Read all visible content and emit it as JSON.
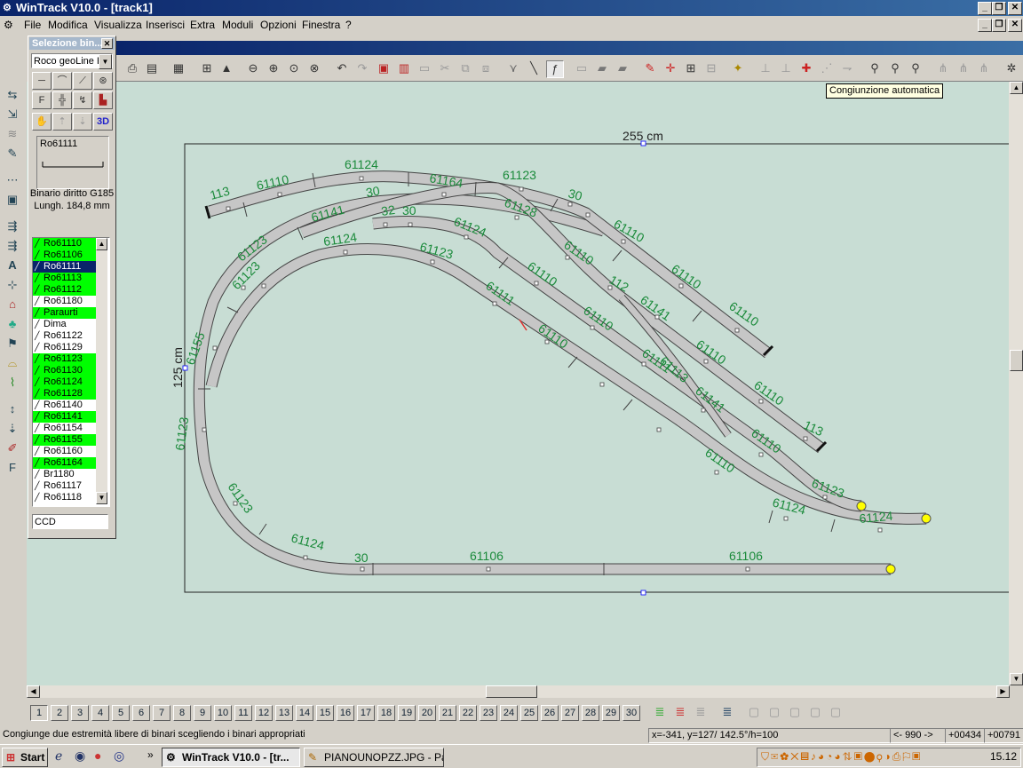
{
  "window": {
    "title": "WinTrack  V10.0 - [track1]",
    "menu": [
      "File",
      "Modifica",
      "Visualizza",
      "Inserisci",
      "Extra",
      "Moduli",
      "Opzioni",
      "Finestra",
      "?"
    ]
  },
  "tooltip": "Congiunzione automatica",
  "palette": {
    "title": "Selezione bin...",
    "dropdown_value": "Roco geoLine R",
    "preview_code": "Ro61111",
    "desc_line1": "Binario diritto G185",
    "desc_line2": "Lungh. 184,8 mm",
    "code_input_value": "CCD",
    "three_d_label": "3D",
    "list": [
      {
        "label": "Ro61110",
        "state": "green"
      },
      {
        "label": "Ro61106",
        "state": "green"
      },
      {
        "label": "Ro61111",
        "state": "selected"
      },
      {
        "label": "Ro61113",
        "state": "green"
      },
      {
        "label": "Ro61112",
        "state": "green"
      },
      {
        "label": "Ro61180",
        "state": "none"
      },
      {
        "label": "Paraurti",
        "state": "green"
      },
      {
        "label": "Dima",
        "state": "none"
      },
      {
        "label": "Ro61122",
        "state": "none"
      },
      {
        "label": "Ro61129",
        "state": "none"
      },
      {
        "label": "Ro61123",
        "state": "green"
      },
      {
        "label": "Ro61130",
        "state": "green"
      },
      {
        "label": "Ro61124",
        "state": "green"
      },
      {
        "label": "Ro61128",
        "state": "green"
      },
      {
        "label": "Ro61140",
        "state": "none"
      },
      {
        "label": "Ro61141",
        "state": "green"
      },
      {
        "label": "Ro61154",
        "state": "none"
      },
      {
        "label": "Ro61155",
        "state": "green"
      },
      {
        "label": "Ro61160",
        "state": "none"
      },
      {
        "label": "Ro61164",
        "state": "green"
      },
      {
        "label": "Br1180",
        "state": "none"
      },
      {
        "label": "Ro61117",
        "state": "none"
      },
      {
        "label": "Ro61118",
        "state": "none"
      }
    ]
  },
  "canvas": {
    "width_label": "255 cm",
    "height_label": "125 cm",
    "track_labels": [
      "113",
      "61110",
      "61124",
      "61164",
      "61123",
      "30",
      "30",
      "61141",
      "32",
      "30",
      "61128",
      "61110",
      "61123",
      "61124",
      "61124",
      "61123",
      "61123",
      "61110",
      "61110",
      "61155",
      "112",
      "61110",
      "61141",
      "61111",
      "61111",
      "61110",
      "61110",
      "61123",
      "61113",
      "61141",
      "61110",
      "61110",
      "61110",
      "61110",
      "113",
      "61123",
      "61124",
      "61124",
      "61106",
      "61106",
      "30",
      "61124",
      "61123",
      "61110"
    ]
  },
  "pagebar": {
    "pages": [
      "1",
      "2",
      "3",
      "4",
      "5",
      "6",
      "7",
      "8",
      "9",
      "10",
      "11",
      "12",
      "13",
      "14",
      "15",
      "16",
      "17",
      "18",
      "19",
      "20",
      "21",
      "22",
      "23",
      "24",
      "25",
      "26",
      "27",
      "28",
      "29",
      "30"
    ],
    "active_page": "1"
  },
  "statusbar": {
    "message": "Congiunge due estremità libere di binari scegliendo i binari appropriati",
    "coords": "x=-341, y=127/ 142.5°/h=100",
    "field2": "<- 990 ->",
    "field3": "+00434",
    "field4": "+00791"
  },
  "taskbar": {
    "start_label": "Start",
    "tasks": [
      "WinTrack  V10.0 - [tr...",
      "PIANOUNOPZZ.JPG - Pa..."
    ],
    "clock": "15.12"
  },
  "colors": {
    "canvas_bg": "#c8ddd4",
    "track_fill": "#c6c6c6",
    "label_green": "#1a8a3a",
    "list_highlight": "#00ff00",
    "selection": "#0a246a",
    "endpoint": "#ffff00"
  }
}
